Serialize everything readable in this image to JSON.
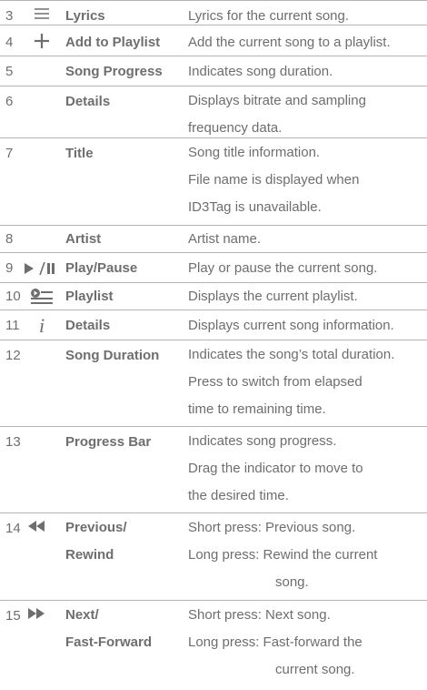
{
  "rows": [
    {
      "num": "3",
      "icon": "lines-icon",
      "name": "Lyrics",
      "desc": [
        "Lyrics for the current song."
      ]
    },
    {
      "num": "4",
      "icon": "plus-icon",
      "name": "Add to Playlist",
      "desc": [
        "Add the current song to a playlist."
      ]
    },
    {
      "num": "5",
      "icon": "",
      "name": "Song Progress",
      "desc": [
        "Indicates song duration."
      ]
    },
    {
      "num": "6",
      "icon": "",
      "name": "Details",
      "desc": [
        "Displays bitrate and sampling",
        "frequency data."
      ]
    },
    {
      "num": "7",
      "icon": "",
      "name": "Title",
      "desc": [
        "Song title information.",
        "File name is displayed when",
        "ID3Tag is unavailable."
      ]
    },
    {
      "num": "8",
      "icon": "",
      "name": "Artist",
      "desc": [
        "Artist name."
      ]
    },
    {
      "num": "9",
      "icon": "play-pause-icon",
      "name": "Play/Pause",
      "desc": [
        "Play or pause the current song."
      ]
    },
    {
      "num": "10",
      "icon": "playlist-icon",
      "name": "Playlist",
      "desc": [
        "Displays the current playlist."
      ]
    },
    {
      "num": "11",
      "icon": "info-i-icon",
      "name": "Details",
      "desc": [
        "Displays current song information."
      ]
    },
    {
      "num": "12",
      "icon": "",
      "name": "Song Duration",
      "desc": [
        "Indicates the song’s total duration.",
        "Press to switch from elapsed",
        "time to remaining time."
      ]
    },
    {
      "num": "13",
      "icon": "",
      "name": "Progress Bar",
      "desc": [
        "Indicates song progress.",
        "Drag the indicator to move to",
        "the desired time."
      ]
    },
    {
      "num": "14",
      "icon": "rewind-icon",
      "name": [
        "Previous/",
        "Rewind"
      ],
      "desc": [
        "Short press: Previous song.",
        "Long press: Rewind the current",
        "song."
      ]
    },
    {
      "num": "15",
      "icon": "fast-forward-icon",
      "name": [
        "Next/",
        "Fast-Forward"
      ],
      "desc": [
        "Short press: Next song.",
        "Long press: Fast-forward the",
        "current song."
      ]
    }
  ],
  "icon_glyphs": {
    "info_i": "i"
  }
}
